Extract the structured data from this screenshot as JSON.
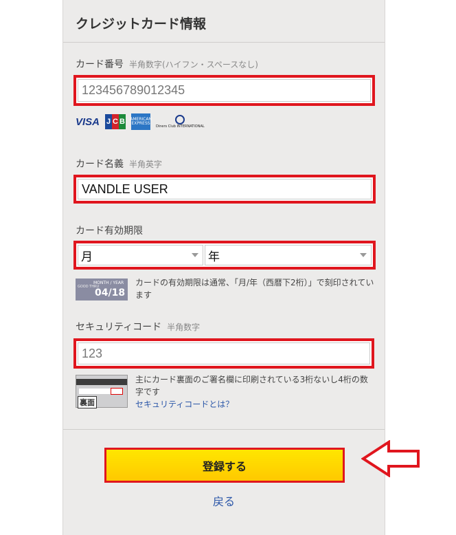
{
  "header": {
    "title": "クレジットカード情報"
  },
  "card_number": {
    "label": "カード番号",
    "hint": "半角数字(ハイフン・スペースなし)",
    "placeholder": "123456789012345"
  },
  "brands": {
    "visa": "VISA",
    "jcb": [
      "J",
      "C",
      "B"
    ],
    "amex": "AMERICAN EXPRESS",
    "diners": "Diners Club INTERNATIONAL"
  },
  "card_name": {
    "label": "カード名義",
    "hint": "半角英字",
    "value": "VANDLE USER"
  },
  "expiry": {
    "label": "カード有効期限",
    "month": "月",
    "year": "年",
    "sample_top": "MONTH / YEAR",
    "sample_value": "04/18",
    "sample_left": "GOOD THRU",
    "note": "カードの有効期限は通常、「月/年（西暦下2桁）」で刻印されています"
  },
  "security": {
    "label": "セキュリティコード",
    "hint": "半角数字",
    "placeholder": "123",
    "card_back_label": "裏面",
    "note": "主にカード裏面のご署名欄に印刷されている3桁ないし4桁の数字です",
    "link": "セキュリティコードとは？"
  },
  "actions": {
    "submit": "登録する",
    "back": "戻る"
  },
  "colors": {
    "highlight": "#e0161e",
    "button": "#ffd600",
    "link": "#2a56a8"
  }
}
